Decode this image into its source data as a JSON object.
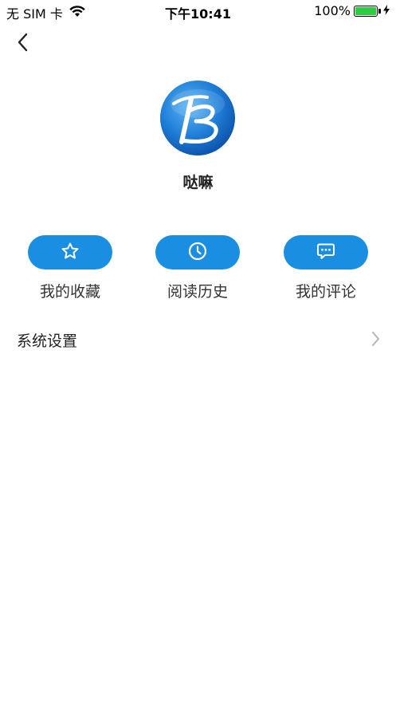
{
  "status_bar": {
    "carrier": "无 SIM 卡",
    "time": "下午10:41",
    "battery_percent": "100%",
    "battery_level": 1.0,
    "wifi_icon": "wifi-icon",
    "charging_icon": "bolt-icon"
  },
  "nav": {
    "back_icon": "chevron-left-icon"
  },
  "profile": {
    "username": "哒嘛",
    "avatar_letter": "B"
  },
  "actions": [
    {
      "label": "我的收藏",
      "icon": "star-icon"
    },
    {
      "label": "阅读历史",
      "icon": "clock-icon"
    },
    {
      "label": "我的评论",
      "icon": "chat-bubble-icon"
    }
  ],
  "settings": {
    "label": "系统设置",
    "icon": "chevron-right-icon"
  },
  "colors": {
    "accent": "#1a8ee1",
    "battery": "#2ecc40",
    "text": "#222222"
  }
}
